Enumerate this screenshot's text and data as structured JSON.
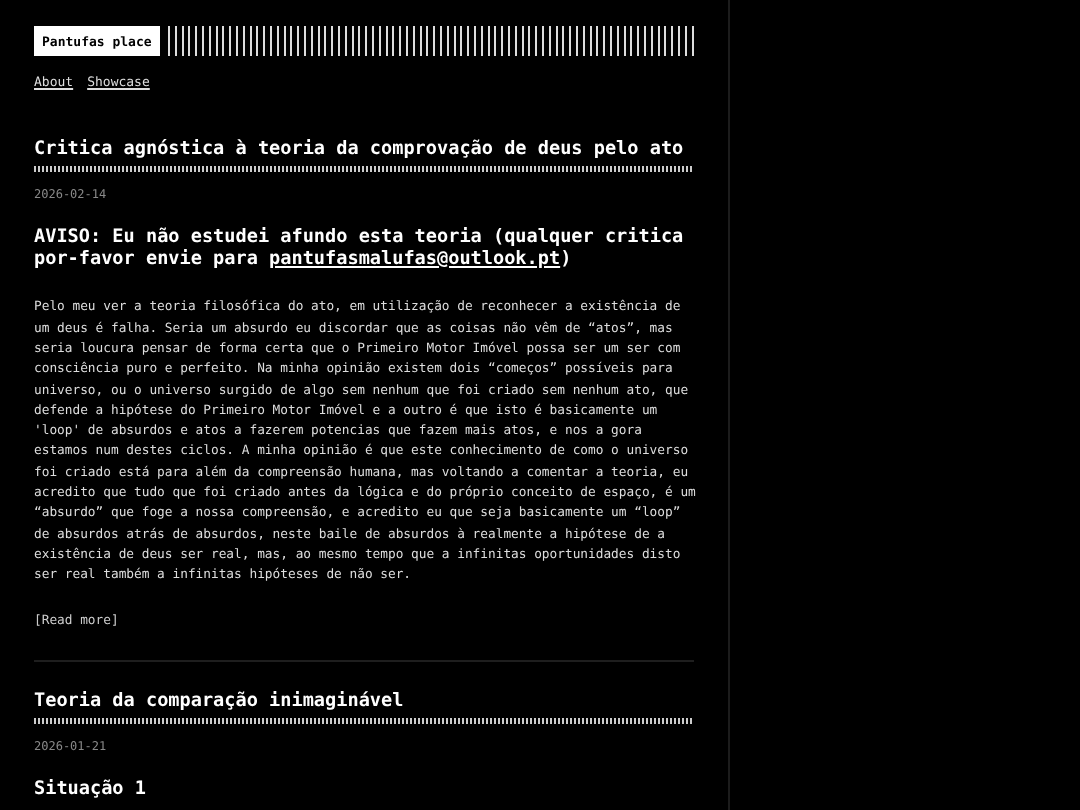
{
  "site": {
    "title": "Pantufas place"
  },
  "nav": [
    {
      "label": "About"
    },
    {
      "label": "Showcase"
    }
  ],
  "posts": [
    {
      "title": "Critica agnóstica à teoria da comprovação de deus pelo ato",
      "date": "2026-02-14",
      "heading": {
        "before": "AVISO: Eu não estudei afundo esta teoria (qualquer critica por-favor envie para ",
        "link": "pantufasmalufas@outlook.pt",
        "after": ")"
      },
      "body": "Pelo meu ver a teoria filosófica do ato, em utilização de reconhecer a existência de um deus é falha. Seria um absurdo eu discordar que as coisas não vêm de “atos”, mas seria loucura pensar de forma certa que o Primeiro Motor Imóvel possa ser um ser com consciência puro e perfeito. Na minha opinião existem dois “começos” possíveis para universo, ou o universo surgido de algo sem nenhum que foi criado sem nenhum ato, que defende a hipótese do Primeiro Motor Imóvel e a outro é que isto é basicamente um 'loop' de absurdos e atos a fazerem potencias que fazem mais atos, e nos a gora estamos num destes ciclos. A minha opinião é que este conhecimento de como o universo foi criado está para além da compreensão humana, mas voltando a comentar a teoria, eu acredito que tudo que foi criado antes da lógica e do próprio conceito de espaço, é um “absurdo” que foge a nossa compreensão, e acredito eu que seja basicamente um “loop” de absurdos atrás de absurdos, neste baile de absurdos à realmente a hipótese de a existência de deus ser real, mas, ao mesmo tempo que a infinitas oportunidades disto ser real também a infinitas hipóteses de não ser.",
      "more": "[Read more]"
    },
    {
      "title": "Teoria da comparação inimaginável",
      "date": "2026-01-21",
      "heading": {
        "before": "Situação 1"
      }
    }
  ]
}
